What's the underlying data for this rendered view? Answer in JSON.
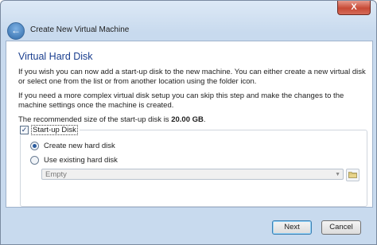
{
  "window": {
    "title": "Create New Virtual Machine",
    "close_symbol": "X"
  },
  "page": {
    "title": "Virtual Hard Disk",
    "paragraph1": "If you wish you can now add a start-up disk to the new machine. You can either create a new virtual disk or select one from the list or from another location using the folder icon.",
    "paragraph2": "If you need a more complex virtual disk setup you can skip this step and make the changes to the machine settings once the machine is created.",
    "recommended_prefix": "The recommended size of the start-up disk is ",
    "recommended_size": "20.00 GB",
    "recommended_suffix": "."
  },
  "startup_disk": {
    "label": "Start-up Disk",
    "checked": true,
    "options": [
      {
        "label": "Create new hard disk",
        "selected": true
      },
      {
        "label": "Use existing hard disk",
        "selected": false
      }
    ],
    "existing_disk_value": "Empty"
  },
  "buttons": {
    "next": "Next",
    "cancel": "Cancel"
  }
}
